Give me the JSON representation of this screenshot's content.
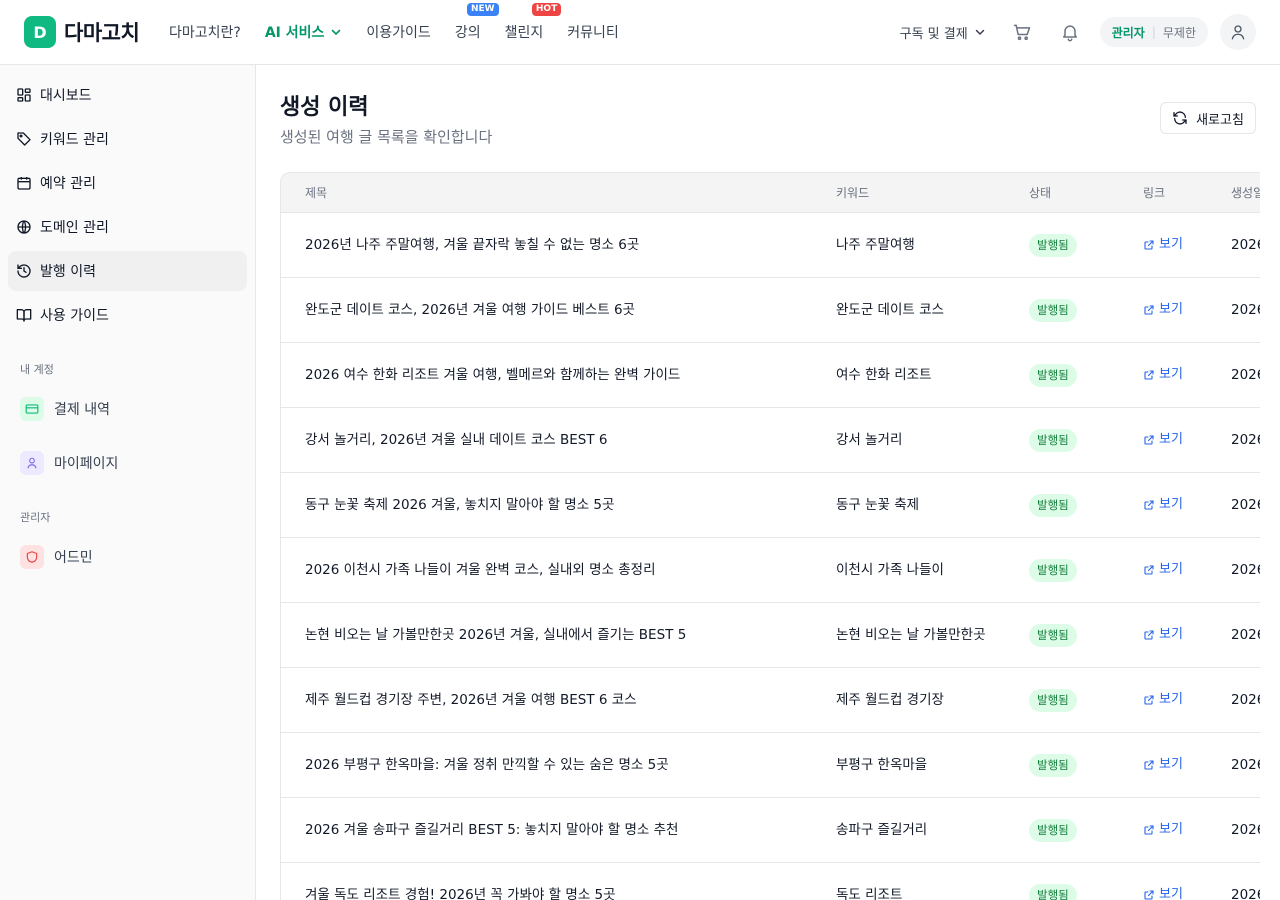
{
  "header": {
    "logo_letter": "D",
    "brand": "다마고치",
    "nav": [
      {
        "label": "다마고치란?"
      },
      {
        "label": "AI 서비스"
      },
      {
        "label": "이용가이드"
      },
      {
        "label": "강의",
        "badge": "NEW"
      },
      {
        "label": "챌린지",
        "badge": "HOT"
      },
      {
        "label": "커뮤니티"
      }
    ],
    "subscription_label": "구독 및 결제",
    "role": "관리자",
    "plan": "무제한"
  },
  "sidebar": {
    "items": [
      {
        "label": "대시보드",
        "icon": "dashboard-icon"
      },
      {
        "label": "키워드 관리",
        "icon": "tag-icon"
      },
      {
        "label": "예약 관리",
        "icon": "calendar-icon"
      },
      {
        "label": "도메인 관리",
        "icon": "globe-icon"
      },
      {
        "label": "발행 이력",
        "icon": "history-icon"
      },
      {
        "label": "사용 가이드",
        "icon": "book-icon"
      }
    ],
    "account_section": "내 계정",
    "account_items": [
      {
        "label": "결제 내역",
        "icon": "card-icon"
      },
      {
        "label": "마이페이지",
        "icon": "user-icon"
      }
    ],
    "admin_section": "관리자",
    "admin_items": [
      {
        "label": "어드민",
        "icon": "shield-icon"
      }
    ]
  },
  "main": {
    "title": "생성 이력",
    "subtitle": "생성된 여행 글 목록을 확인합니다",
    "refresh_label": "새로고침",
    "columns": {
      "title": "제목",
      "keyword": "키워드",
      "status": "상태",
      "link": "링크",
      "date": "생성일"
    },
    "rows": [
      {
        "title": "2026년 나주 주말여행, 겨울 끝자락 놓칠 수 없는 명소 6곳",
        "keyword": "나주 주말여행",
        "status": "발행됨",
        "link": "보기",
        "date": "2026"
      },
      {
        "title": "완도군 데이트 코스, 2026년 겨울 여행 가이드 베스트 6곳",
        "keyword": "완도군 데이트 코스",
        "status": "발행됨",
        "link": "보기",
        "date": "2026"
      },
      {
        "title": "2026 여수 한화 리조트 겨울 여행, 벨메르와 함께하는 완벽 가이드",
        "keyword": "여수 한화 리조트",
        "status": "발행됨",
        "link": "보기",
        "date": "2026"
      },
      {
        "title": "강서 놀거리, 2026년 겨울 실내 데이트 코스 BEST 6",
        "keyword": "강서 놀거리",
        "status": "발행됨",
        "link": "보기",
        "date": "2026"
      },
      {
        "title": "동구 눈꽃 축제 2026 겨울, 놓치지 말아야 할 명소 5곳",
        "keyword": "동구 눈꽃 축제",
        "status": "발행됨",
        "link": "보기",
        "date": "2026"
      },
      {
        "title": "2026 이천시 가족 나들이 겨울 완벽 코스, 실내외 명소 총정리",
        "keyword": "이천시 가족 나들이",
        "status": "발행됨",
        "link": "보기",
        "date": "2026"
      },
      {
        "title": "논현 비오는 날 가볼만한곳 2026년 겨울, 실내에서 즐기는 BEST 5",
        "keyword": "논현 비오는 날 가볼만한곳",
        "status": "발행됨",
        "link": "보기",
        "date": "2026"
      },
      {
        "title": "제주 월드컵 경기장 주변, 2026년 겨울 여행 BEST 6 코스",
        "keyword": "제주 월드컵 경기장",
        "status": "발행됨",
        "link": "보기",
        "date": "2026"
      },
      {
        "title": "2026 부평구 한옥마을: 겨울 정취 만끽할 수 있는 숨은 명소 5곳",
        "keyword": "부평구 한옥마을",
        "status": "발행됨",
        "link": "보기",
        "date": "2026"
      },
      {
        "title": "2026 겨울 송파구 즐길거리 BEST 5: 놓치지 말아야 할 명소 추천",
        "keyword": "송파구 즐길거리",
        "status": "발행됨",
        "link": "보기",
        "date": "2026"
      },
      {
        "title": "겨울 독도 리조트 경험! 2026년 꼭 가봐야 할 명소 5곳",
        "keyword": "독도 리조트",
        "status": "발행됨",
        "link": "보기",
        "date": "2026"
      }
    ]
  },
  "colors": {
    "brand": "#10b981",
    "link": "#2563eb",
    "status_bg": "#dcfce7",
    "status_text": "#15803d"
  }
}
